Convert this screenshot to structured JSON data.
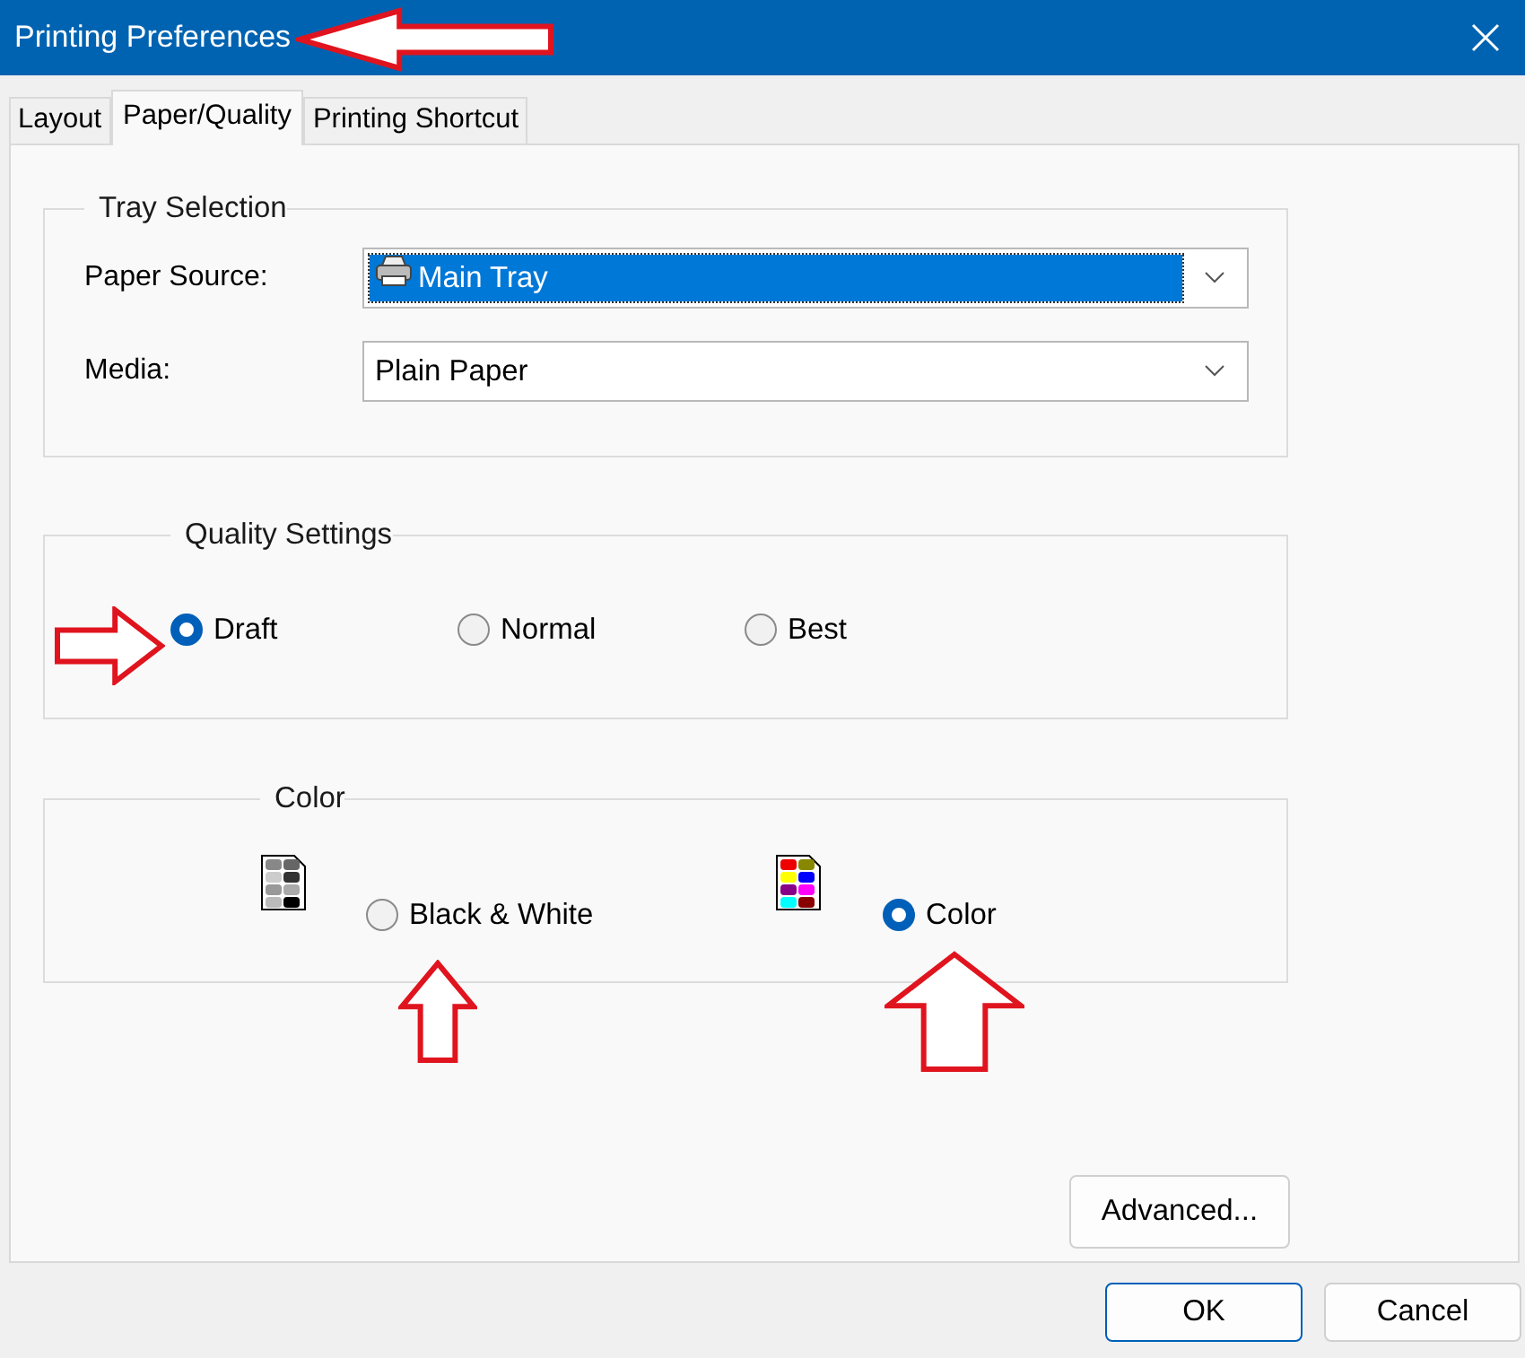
{
  "window": {
    "title": "Printing Preferences"
  },
  "tabs": [
    {
      "label": "Layout",
      "selected": false
    },
    {
      "label": "Paper/Quality",
      "selected": true
    },
    {
      "label": "Printing Shortcut",
      "selected": false
    }
  ],
  "tray_selection": {
    "title": "Tray Selection",
    "fields": [
      {
        "label": "Paper Source:",
        "value": "Main Tray",
        "kind": "tray",
        "highlighted": true
      },
      {
        "label": "Media:",
        "value": "Plain Paper",
        "kind": "media",
        "highlighted": false
      }
    ]
  },
  "quality_settings": {
    "title": "Quality Settings",
    "options": [
      {
        "label": "Draft",
        "selected": true
      },
      {
        "label": "Normal",
        "selected": false
      },
      {
        "label": "Best",
        "selected": false
      }
    ]
  },
  "color": {
    "title": "Color",
    "options": [
      {
        "label": "Black & White",
        "kind": "mono",
        "selected": false
      },
      {
        "label": "Color",
        "kind": "color",
        "selected": true
      }
    ]
  },
  "buttons": {
    "advanced": "Advanced...",
    "ok": "OK",
    "cancel": "Cancel"
  }
}
